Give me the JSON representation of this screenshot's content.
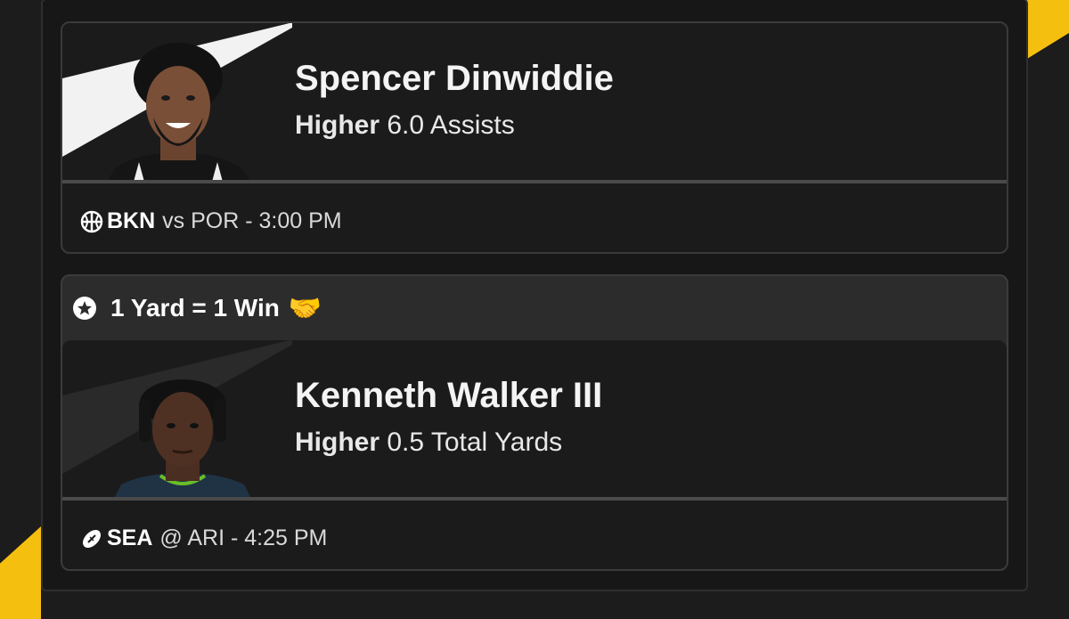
{
  "colors": {
    "accent": "#f5bf0f",
    "background": "#1c1c1c",
    "card": "#1b1b1b",
    "promo_bar": "#2c2c2c"
  },
  "picks": [
    {
      "player_name": "Spencer Dinwiddie",
      "direction": "Higher",
      "line_text": "6.0 Assists",
      "sport_icon": "basketball-icon",
      "team": "BKN",
      "matchup": "vs POR - 3:00 PM"
    },
    {
      "promo": {
        "icon": "star-icon",
        "text": "1 Yard = 1 Win",
        "emoji": "🤝"
      },
      "player_name": "Kenneth Walker III",
      "direction": "Higher",
      "line_text": "0.5 Total Yards",
      "sport_icon": "football-icon",
      "team": "SEA",
      "matchup": "@ ARI - 4:25 PM"
    }
  ]
}
